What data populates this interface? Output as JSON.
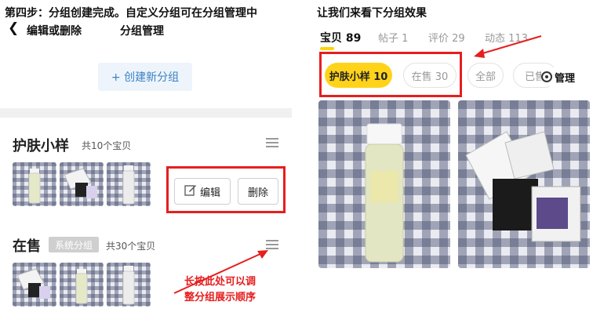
{
  "left": {
    "step_title": "第四步：分组创建完成。自定义分组可在分组管理中",
    "edit_or_delete": "编辑或删除",
    "nav_title": "分组管理",
    "create_group": "+ 创建新分组",
    "groups": [
      {
        "name": "护肤小样",
        "count": "共10个宝贝"
      },
      {
        "name": "在售",
        "tag": "系统分组",
        "count": "共30个宝贝"
      }
    ],
    "edit_label": "编辑",
    "delete_label": "删除",
    "annotation_line1": "长按此处可以调",
    "annotation_line2": "整分组展示顺序"
  },
  "right": {
    "title": "让我们来看下分组效果",
    "tabs": [
      {
        "label": "宝贝",
        "count": "89"
      },
      {
        "label": "帖子",
        "count": "1"
      },
      {
        "label": "评价",
        "count": "29"
      },
      {
        "label": "动态",
        "count": "113"
      }
    ],
    "pills": [
      {
        "label": "护肤小样 10"
      },
      {
        "label": "在售 30"
      },
      {
        "label": "全部"
      },
      {
        "label": "已售"
      }
    ],
    "manage_label": "管理"
  },
  "colors": {
    "annotation_red": "#e61e1e",
    "accent_yellow": "#ffd31a",
    "link_blue": "#3b82c4"
  }
}
